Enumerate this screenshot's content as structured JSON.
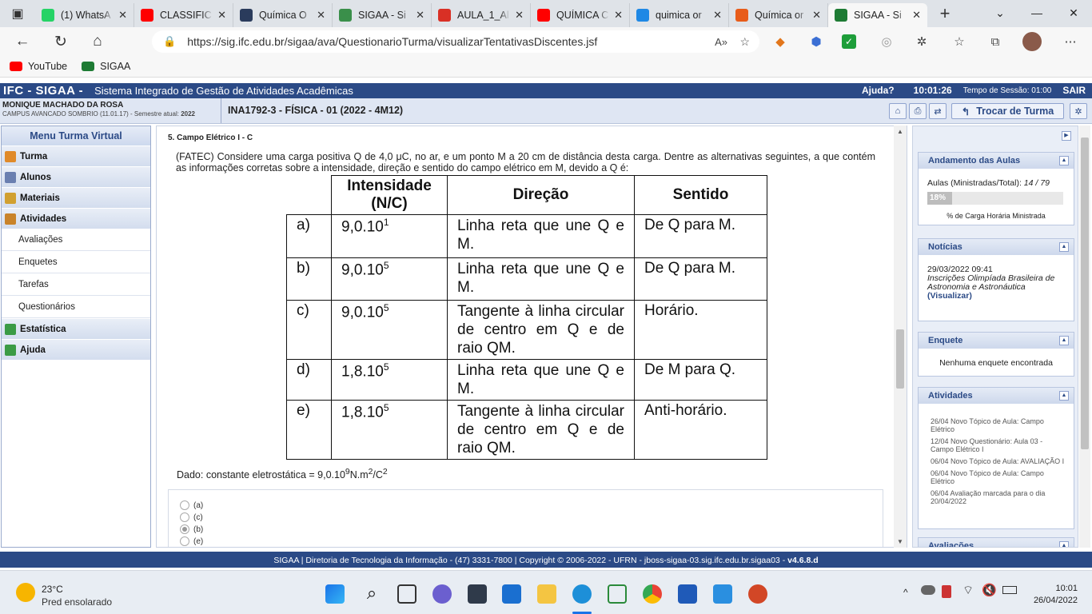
{
  "browser": {
    "tabs": [
      {
        "title": "(1) WhatsA",
        "color": "#25d366"
      },
      {
        "title": "CLASSIFIC",
        "color": "#ff0000"
      },
      {
        "title": "Química O",
        "color": "#2a3b5c"
      },
      {
        "title": "SIGAA - Si",
        "color": "#3a8f4a"
      },
      {
        "title": "AULA_1_Al",
        "color": "#d93025"
      },
      {
        "title": "QUÍMICA C",
        "color": "#ff0000"
      },
      {
        "title": "quimica or",
        "color": "#1e88e5"
      },
      {
        "title": "Química or",
        "color": "#e85c1a"
      },
      {
        "title": "SIGAA - Si",
        "color": "#1e7b34",
        "active": true
      }
    ],
    "url": "https://sig.ifc.edu.br/sigaa/ava/QuestionarioTurma/visualizarTentativasDiscentes.jsf",
    "bookmarks": [
      {
        "label": "YouTube",
        "color": "#ff0000"
      },
      {
        "label": "SIGAA",
        "color": "#1e7b34"
      }
    ]
  },
  "sigaa": {
    "logo": "IFC - SIGAA -",
    "system_name": "Sistema Integrado de Gestão de Atividades Acadêmicas",
    "help": "Ajuda?",
    "time": "10:01:26",
    "session_label": "Tempo de Sessão: 01:00",
    "exit": "SAIR",
    "user_name": "MONIQUE MACHADO DA ROSA",
    "campus": "CAMPUS AVANCADO SOMBRIO (11.01.17) - Semestre atual: ",
    "semester": "2022",
    "course": "INA1792-3 - FÍSICA - 01 (2022 - 4M12)",
    "change_class": "Trocar de Turma"
  },
  "menu": {
    "title": "Menu Turma Virtual",
    "groups": [
      {
        "label": "Turma"
      },
      {
        "label": "Alunos"
      },
      {
        "label": "Materiais"
      },
      {
        "label": "Atividades"
      },
      {
        "label": "Estatística"
      },
      {
        "label": "Ajuda"
      }
    ],
    "sub_items": [
      "Avaliações",
      "Enquetes",
      "Tarefas",
      "Questionários"
    ]
  },
  "question": {
    "title": "5. Campo Elétrico I - C",
    "text": "(FATEC) Considere uma carga positiva Q de 4,0 μC, no ar, e um ponto M a 20 cm de distância desta carga. Dentre as alternativas seguintes, a que contém as informações corretas sobre a intensidade, direção e sentido do campo elétrico em M, devido a Q é:",
    "headers": [
      "Intensidade (N/C)",
      "Direção",
      "Sentido"
    ],
    "rows": [
      {
        "letter": "a)",
        "base": "9,0.10",
        "exp": "1",
        "dir": "Linha reta que une Q e M.",
        "sense": "De Q para M."
      },
      {
        "letter": "b)",
        "base": "9,0.10",
        "exp": "5",
        "dir": "Linha reta que une Q e M.",
        "sense": "De Q para M."
      },
      {
        "letter": "c)",
        "base": "9,0.10",
        "exp": "5",
        "dir": "Tangente à linha circular de centro em Q e de raio QM.",
        "sense": "Horário."
      },
      {
        "letter": "d)",
        "base": "1,8.10",
        "exp": "5",
        "dir": "Linha reta que une Q e M.",
        "sense": "De M para Q."
      },
      {
        "letter": "e)",
        "base": "1,8.10",
        "exp": "5",
        "dir": "Tangente à linha circular de centro em Q e de raio QM.",
        "sense": "Anti-horário."
      }
    ],
    "given_prefix": "Dado: constante eletrostática = 9,0.10",
    "given_exp1": "9",
    "given_mid": "N.m",
    "given_exp2": "2",
    "given_mid2": "/C",
    "given_exp3": "2",
    "options": [
      {
        "label": "(a)",
        "selected": false
      },
      {
        "label": "(c)",
        "selected": false
      },
      {
        "label": "(b)",
        "selected": true
      },
      {
        "label": "(e)",
        "selected": false
      }
    ]
  },
  "right": {
    "progress_title": "Andamento das Aulas",
    "progress_label": "Aulas (Ministradas/Total): ",
    "progress_value": "14 / 79",
    "progress_percent_text": "18%",
    "progress_fraction": 0.18,
    "progress_caption": "% de Carga Horária Ministrada",
    "news_title": "Notícias",
    "news_date": "29/03/2022 09:41",
    "news_text": "Inscrições Olimpíada Brasileira de Astronomia e Astronáutica",
    "news_link": "(Visualizar)",
    "poll_title": "Enquete",
    "poll_text": "Nenhuma enquete encontrada",
    "activities_title": "Atividades",
    "activities": [
      "26/04 Novo Tópico de Aula: Campo Elétrico",
      "12/04 Novo Questionário: Aula 03 - Campo Elétrico I",
      "06/04 Novo Tópico de Aula: AVALIAÇÃO I",
      "06/04 Novo Tópico de Aula: Campo Elétrico",
      "06/04 Avaliação marcada para o dia 20/04/2022"
    ],
    "evaluations_title": "Avaliações"
  },
  "footer": {
    "text": "SIGAA | Diretoria de Tecnologia da Informação - (47) 3331-7800 | Copyright © 2006-2022 - UFRN - jboss-sigaa-03.sig.ifc.edu.br.sigaa03 - ",
    "version": "v4.6.8.d"
  },
  "taskbar": {
    "temp": "23°C",
    "weather": "Pred ensolarado",
    "clock_time": "10:01",
    "clock_date": "26/04/2022"
  }
}
